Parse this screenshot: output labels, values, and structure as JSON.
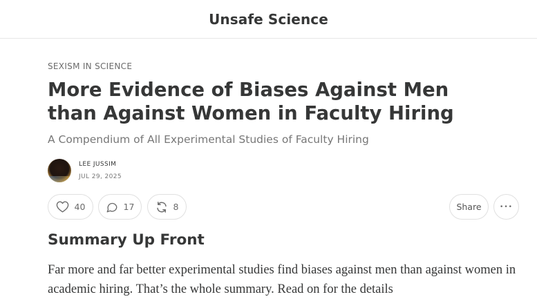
{
  "header": {
    "publication_title": "Unsafe Science"
  },
  "post": {
    "section": "SEXISM IN SCIENCE",
    "title": "More Evidence of Biases Against Men than Against Women in Faculty Hiring",
    "subtitle": "A Compendium of All Experimental Studies of Faculty Hiring",
    "author": "LEE JUSSIM",
    "date": "JUL 29, 2025"
  },
  "actions": {
    "likes": "40",
    "comments": "17",
    "restacks": "8",
    "share_label": "Share",
    "more_label": "•••"
  },
  "content": {
    "heading": "Summary Up Front",
    "paragraph": "Far more and far better experimental studies find biases against men than against women in academic hiring. That’s the whole summary. Read on for the details"
  },
  "icons": [
    "heart-icon",
    "comment-icon",
    "restack-icon",
    "more-icon"
  ],
  "colors": {
    "text": "#363737",
    "muted": "#777777",
    "border": "#e0e0e0"
  }
}
